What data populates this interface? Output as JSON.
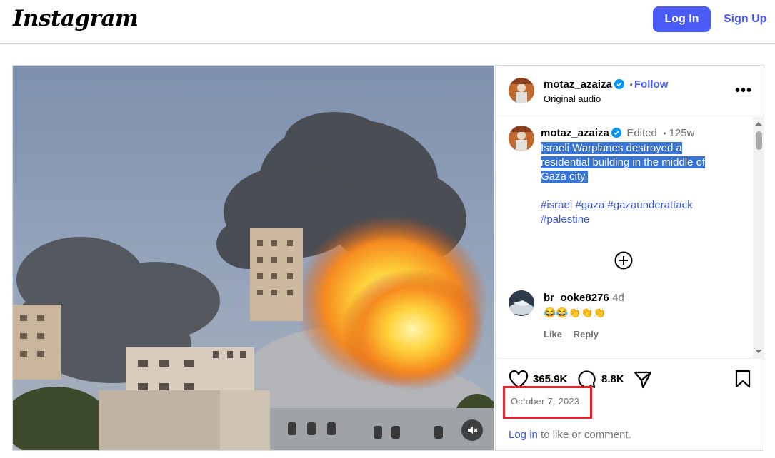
{
  "header": {
    "logo_text": "Instagram",
    "login_label": "Log In",
    "signup_label": "Sign Up"
  },
  "post": {
    "author": "motaz_azaiza",
    "follow_label": "Follow",
    "dot_separator": "•",
    "audio_label": "Original audio",
    "more_label": "•••",
    "caption": {
      "author": "motaz_azaiza",
      "edited_label": "Edited",
      "age": "125w",
      "text_lines": [
        "Israeli Warplanes destroyed a",
        "residential building in the middle of",
        "Gaza city."
      ],
      "hashtags": [
        "#israel",
        "#gaza",
        "#gazaunderattack",
        "#palestine"
      ]
    },
    "comment": {
      "author": "br_ooke8276",
      "age": "4d",
      "emojis": "😂😂👏👏👏",
      "like_label": "Like",
      "reply_label": "Reply"
    },
    "likes": "365.9K",
    "comments_count": "8.8K",
    "date": "October 7, 2023",
    "login_prompt_link": "Log in",
    "login_prompt_rest": "to like or comment."
  },
  "colors": {
    "brand_blue": "#4a5cf7",
    "link_blue": "#3b5ad0",
    "highlight_red": "#e4232b",
    "selection_blue": "#3875d6"
  }
}
